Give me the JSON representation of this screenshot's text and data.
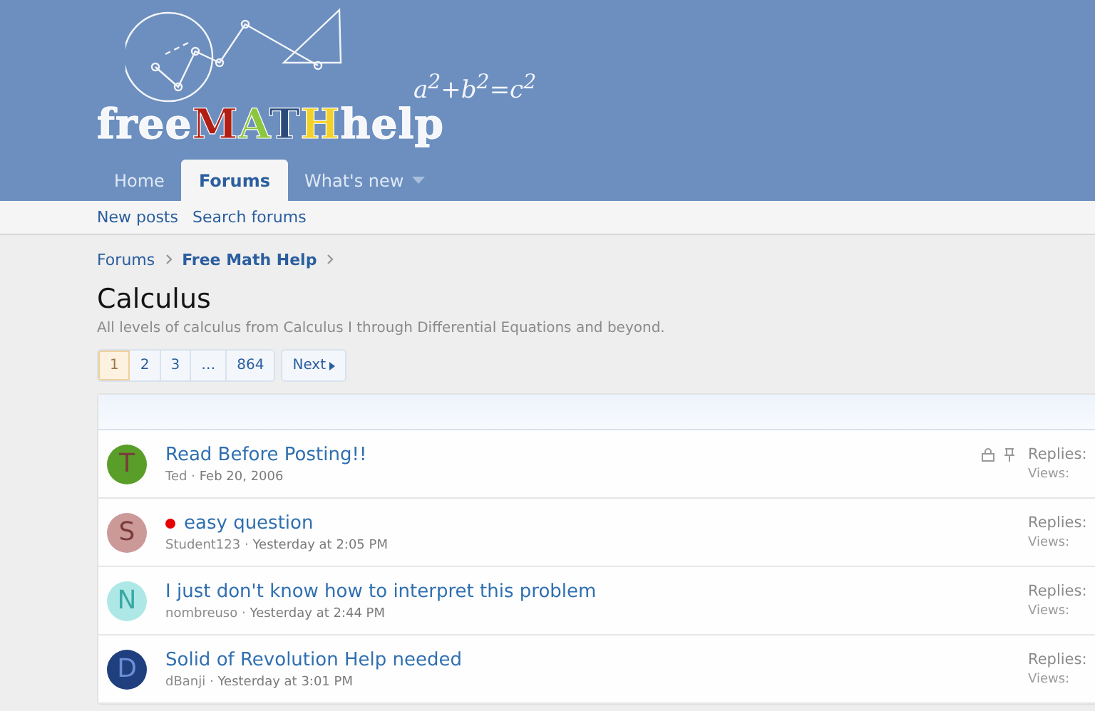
{
  "logo": {
    "formula": "a$^{2}$+b$^{2}$=c$^{2}$",
    "segments": [
      {
        "text": "free",
        "color": "#f4f6fa"
      },
      {
        "text": "M",
        "color": "#b01e14"
      },
      {
        "text": "A",
        "color": "#8cc63f"
      },
      {
        "text": "T",
        "color": "#2a4a7c"
      },
      {
        "text": "H",
        "color": "#f2d12a"
      },
      {
        "text": "help",
        "color": "#f4f6fa"
      }
    ]
  },
  "tabs": [
    {
      "label": "Home",
      "selected": false,
      "caret": false
    },
    {
      "label": "Forums",
      "selected": true,
      "caret": false
    },
    {
      "label": "What's new",
      "selected": false,
      "caret": true
    }
  ],
  "subnav": [
    "New posts",
    "Search forums"
  ],
  "breadcrumbs": [
    {
      "label": "Forums",
      "current": false
    },
    {
      "label": "Free Math Help",
      "current": true
    }
  ],
  "title": "Calculus",
  "description": "All levels of calculus from Calculus I through Differential Equations and beyond.",
  "pagination": [
    {
      "label": "1",
      "selected": true
    },
    {
      "label": "2",
      "selected": false
    },
    {
      "label": "3",
      "selected": false
    },
    {
      "label": "…",
      "selected": false
    },
    {
      "label": "864",
      "selected": false
    }
  ],
  "next_button": "Next",
  "meta_separator": "·",
  "threads": [
    {
      "initial": "T",
      "color": "#5a9e2a",
      "title": "Read Before Posting!!",
      "author": "Ted",
      "date": "Feb 20, 2006",
      "unread_dot": false,
      "locked": true,
      "sticky": true,
      "replies_label": "Replies:",
      "views_label": "Views:"
    },
    {
      "initial": "S",
      "color": "#cc9999",
      "title": "easy question",
      "author": "Student123",
      "date": "Yesterday at 2:05 PM",
      "unread_dot": true,
      "locked": false,
      "sticky": false,
      "replies_label": "Replies:",
      "views_label": "Views:"
    },
    {
      "initial": "N",
      "color": "#aee8e6",
      "title": "I just don't know how to interpret this problem",
      "author": "nombreuso",
      "date": "Yesterday at 2:44 PM",
      "unread_dot": false,
      "locked": false,
      "sticky": false,
      "replies_label": "Replies:",
      "views_label": "Views:"
    },
    {
      "initial": "D",
      "color": "#1f3f7f",
      "title": "Solid of Revolution Help needed",
      "author": "dBanji",
      "date": "Yesterday at 3:01 PM",
      "unread_dot": false,
      "locked": false,
      "sticky": false,
      "replies_label": "Replies:",
      "views_label": "Views:"
    }
  ]
}
